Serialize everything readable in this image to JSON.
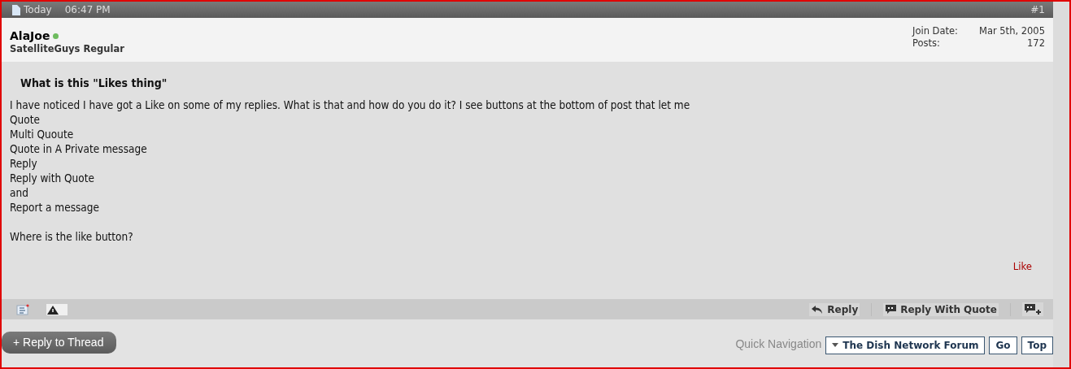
{
  "post": {
    "date": "Today",
    "time": "06:47 PM",
    "number": "#1",
    "author": {
      "name": "AlaJoe",
      "online": true,
      "rank": "SatelliteGuys Regular"
    },
    "stats": [
      {
        "label": "Join Date:",
        "value": "Mar 5th, 2005"
      },
      {
        "label": "Posts:",
        "value": "172"
      }
    ],
    "title": "What is this \"Likes thing\"",
    "paragraphs": [
      [
        "I have noticed I have got a Like on some of my replies. What is that and how do you do it? I see buttons at the bottom of post that let me",
        "Quote",
        "Multi Quoute",
        "Quote in A Private message",
        "Reply",
        "Reply with Quote",
        "and",
        "Report a message"
      ],
      [
        "Where is the like button?"
      ]
    ],
    "like_link": "Like",
    "actions": [
      {
        "kind": "reply",
        "label": "Reply"
      },
      {
        "kind": "quote",
        "label": "Reply With Quote"
      },
      {
        "kind": "multiquote"
      }
    ]
  },
  "reply_button": "+ Reply to Thread",
  "quick_nav": {
    "label": "Quick Navigation",
    "forum": "The Dish Network Forum",
    "buttons": [
      "Go",
      "Top"
    ]
  }
}
